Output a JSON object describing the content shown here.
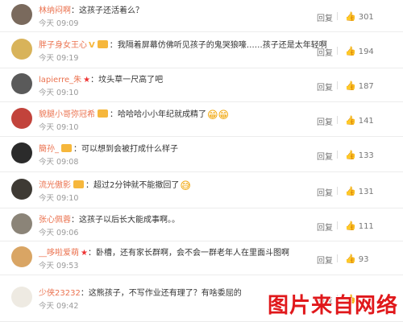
{
  "comments": [
    {
      "name": "林纳闷啊",
      "badge": false,
      "vip": false,
      "star": false,
      "text": "这孩子还活着么？",
      "emoji": "",
      "time": "今天 09:09",
      "reply": "回复",
      "likes": "301",
      "avatar_color": "#7a6a5d"
    },
    {
      "name": "胖子身女王心",
      "badge": true,
      "vip": true,
      "star": false,
      "text": "我隔着屏幕仿佛听见孩子的鬼哭狼嚎……孩子还是太年轻啊",
      "emoji": "",
      "time": "今天 09:19",
      "reply": "回复",
      "likes": "194",
      "avatar_color": "#d8b35a"
    },
    {
      "name": "lapierre_朱",
      "badge": false,
      "vip": false,
      "star": true,
      "text": "坟头草一尺高了吧",
      "emoji": "",
      "time": "今天 09:10",
      "reply": "回复",
      "likes": "187",
      "avatar_color": "#5a5a5a"
    },
    {
      "name": "貌腿小哥弥冠希",
      "badge": true,
      "vip": false,
      "star": false,
      "text": "哈哈哈小小年纪就成精了",
      "emoji": "😁😁",
      "time": "今天 09:10",
      "reply": "回复",
      "likes": "141",
      "avatar_color": "#c2433b"
    },
    {
      "name": "簡孙_",
      "badge": true,
      "vip": false,
      "star": false,
      "text": "可以想到会被打成什么样子",
      "emoji": "",
      "time": "今天 09:08",
      "reply": "回复",
      "likes": "133",
      "avatar_color": "#2b2b2b"
    },
    {
      "name": "流光傲影",
      "badge": true,
      "vip": false,
      "star": false,
      "text": "超过2分钟就不能撤回了",
      "emoji": "😅",
      "time": "今天 09:10",
      "reply": "回复",
      "likes": "131",
      "avatar_color": "#3e3a34"
    },
    {
      "name": "张心佩蓉",
      "badge": false,
      "vip": false,
      "star": false,
      "text": "这孩子以后长大能成事啊。。",
      "emoji": "",
      "time": "今天 09:06",
      "reply": "回复",
      "likes": "111",
      "avatar_color": "#8b8478"
    },
    {
      "name": "__哆啦爱萌",
      "badge": false,
      "vip": false,
      "star": true,
      "text": "卧槽，还有家长群啊，会不会一群老年人在里面斗图啊",
      "emoji": "",
      "time": "今天 09:53",
      "reply": "回复",
      "likes": "93",
      "avatar_color": "#d9a564"
    },
    {
      "name": "少侠23232",
      "badge": false,
      "vip": false,
      "star": false,
      "text": "这熊孩子，不写作业还有理了？有啥委屈的",
      "emoji": "",
      "time": "今天 09:42",
      "reply": "回复",
      "likes": "",
      "avatar_color": "#eeeae2"
    }
  ],
  "watermark": "图片来自网络"
}
